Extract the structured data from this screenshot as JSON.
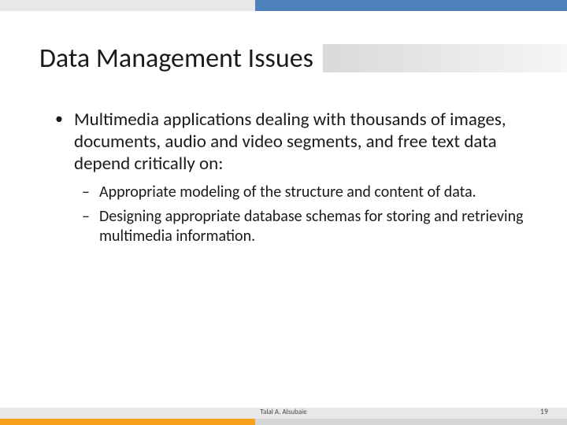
{
  "title": "Data Management Issues",
  "bullets": {
    "lead": "Multimedia applications dealing with thousands of images, documents, audio and video segments, and free text data depend critically on:",
    "subs": [
      "Appropriate modeling of the structure and content of data.",
      "Designing appropriate database schemas for storing and retrieving multimedia information."
    ]
  },
  "footer": {
    "author": "Talal A. Alsubaie",
    "page": "19"
  },
  "glyphs": {
    "dot": "•",
    "dash": "–"
  }
}
